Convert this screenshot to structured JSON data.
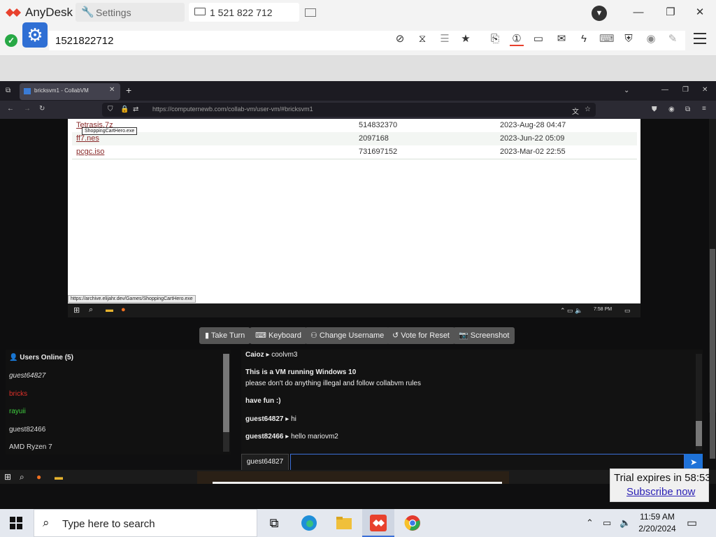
{
  "anydesk": {
    "app_name": "AnyDesk",
    "settings_tab": "Settings",
    "remote_tab": "1 521 822 712",
    "address": "1521822712",
    "trial_text": "Trial expires in 58:53",
    "subscribe_link": "Subscribe now"
  },
  "firefox": {
    "tab_title": "bricksvm1 - CollabVM",
    "url": "https://computernewb.com/collab-vm/user-vm/#bricksvm1"
  },
  "files": [
    {
      "name": "Tetrasis.7z",
      "size": "514832370",
      "date": "2023-Aug-28 04:47"
    },
    {
      "name": "ff7.nes",
      "size": "2097168",
      "date": "2023-Jun-22 05:09"
    },
    {
      "name": "pcgc.iso",
      "size": "731697152",
      "date": "2023-Mar-02 22:55"
    }
  ],
  "tooltip": "ShoppingCartHero.exe",
  "status_url": "https://archive.elijahr.dev/Games/ShoppingCartHero.exe",
  "vm_time": "7:58 PM",
  "controls": {
    "take_turn": "Take Turn",
    "keyboard": "Keyboard",
    "change_username": "Change Username",
    "vote_reset": "Vote for Reset",
    "screenshot": "Screenshot"
  },
  "users": {
    "heading": "Users Online (5)",
    "list": [
      {
        "name": "guest64827",
        "color": "#dddddd"
      },
      {
        "name": "bricks",
        "color": "#e0302a"
      },
      {
        "name": "rayuii",
        "color": "#3fcf3f"
      },
      {
        "name": "guest82466",
        "color": "#dddddd"
      },
      {
        "name": "AMD Ryzen 7",
        "color": "#dddddd"
      }
    ]
  },
  "chat": [
    {
      "user": "Caioz",
      "msg": "coolvm3"
    },
    {
      "user": "",
      "msg": "This is a VM running Windows 10"
    },
    {
      "user": "",
      "msg": "please don't do anything illegal and follow collabvm rules"
    },
    {
      "user": "",
      "msg": "have fun :)"
    },
    {
      "user": "guest64827",
      "msg": "hi"
    },
    {
      "user": "guest82466",
      "msg": "hello mariovm2"
    }
  ],
  "chat_input": {
    "username": "guest64827",
    "value": ""
  },
  "host": {
    "search_placeholder": "Type here to search",
    "time": "11:59 AM",
    "date": "2/20/2024"
  }
}
